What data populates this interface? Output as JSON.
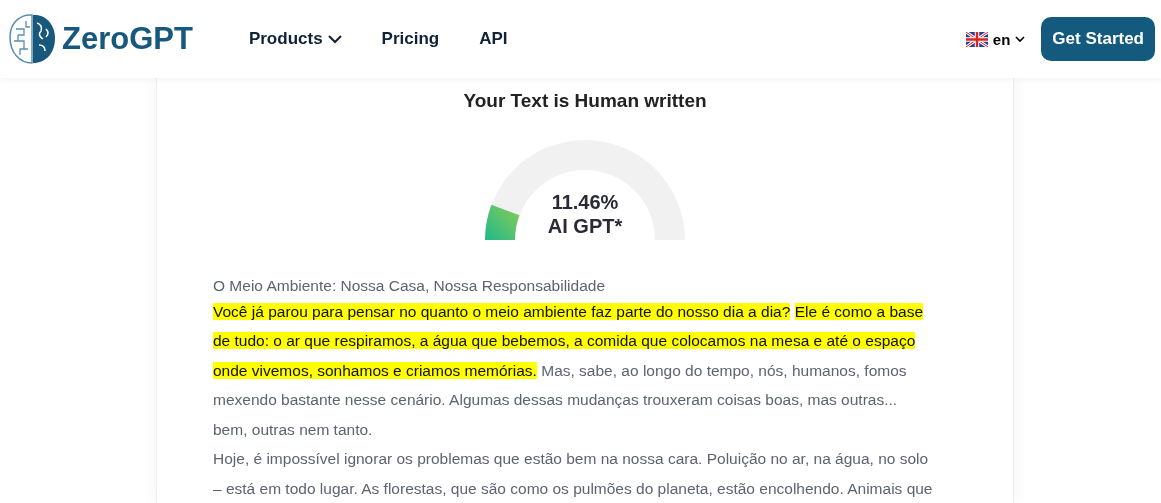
{
  "header": {
    "logo_text": "ZeroGPT",
    "nav": [
      {
        "label": "Products",
        "has_menu": true
      },
      {
        "label": "Pricing",
        "has_menu": false
      },
      {
        "label": "API",
        "has_menu": false
      }
    ],
    "language": "en",
    "cta": "Get Started"
  },
  "result": {
    "title": "Your Text is Human written",
    "gauge": {
      "level": 0.1146,
      "value": "11.46%",
      "label": "AI GPT*"
    },
    "heading": "O Meio Ambiente: Nossa Casa, Nossa Responsabilidade",
    "paragraphs": [
      {
        "segments": [
          {
            "text": "Você já parou para pensar no quanto o meio ambiente faz parte do nosso dia a dia?",
            "highlighted": true
          },
          {
            "text": "Ele é como a base de tudo: o ar que respiramos, a água que bebemos, a comida que colocamos na mesa e até o espaço onde vivemos, sonhamos e criamos memórias.",
            "highlighted": true
          },
          {
            "text": "Mas, sabe, ao longo do tempo, nós, humanos, fomos mexendo bastante nesse cenário. Algumas dessas mudanças trouxeram coisas boas, mas outras... bem, outras nem tanto.",
            "highlighted": false
          }
        ]
      },
      {
        "segments": [
          {
            "text": "Hoje, é impossível ignorar os problemas que estão bem na nossa cara. Poluição no ar, na água, no solo – está em todo lugar. As florestas, que são como os pulmões do planeta, estão encolhendo. Animais que",
            "highlighted": false
          }
        ]
      }
    ]
  }
}
